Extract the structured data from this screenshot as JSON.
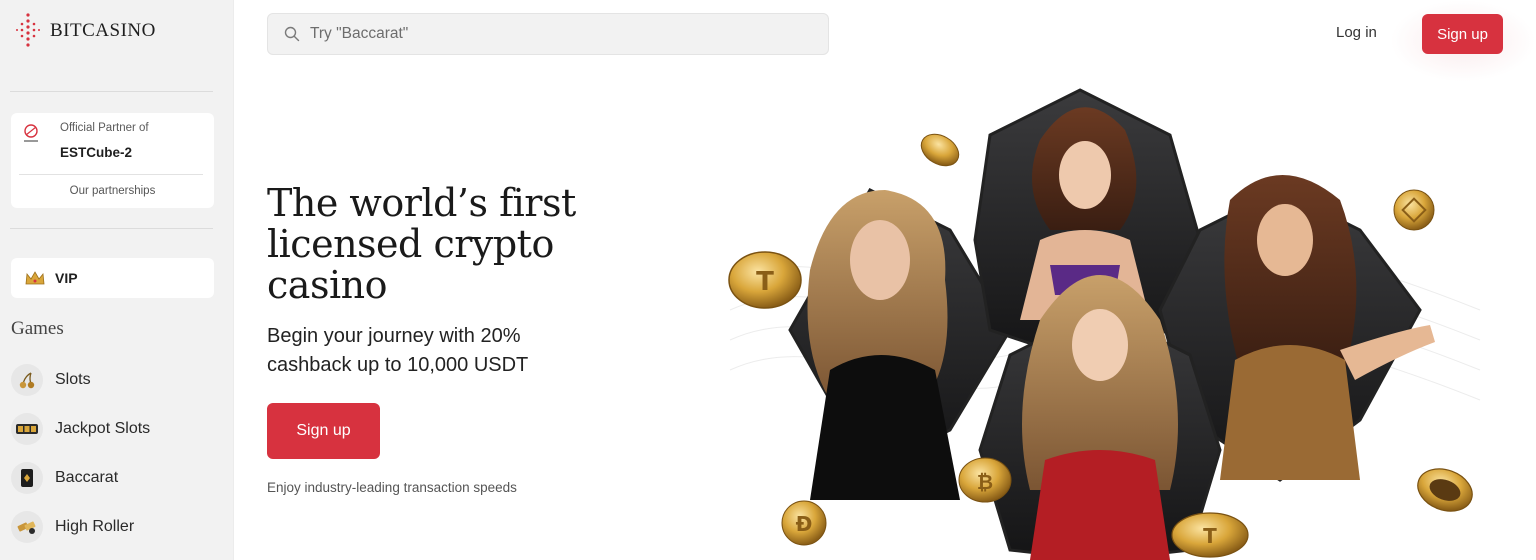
{
  "brand": {
    "name": "BITCASINO",
    "accent": "#d7323f"
  },
  "partner": {
    "label": "Official Partner of",
    "name": "ESTCube-2",
    "link": "Our partnerships"
  },
  "sidebar": {
    "vip": {
      "label": "VIP",
      "icon": "crown-icon"
    },
    "section_title": "Games",
    "items": [
      {
        "label": "Slots",
        "icon": "cherries-icon"
      },
      {
        "label": "Jackpot Slots",
        "icon": "slot-reels-icon"
      },
      {
        "label": "Baccarat",
        "icon": "card-icon"
      },
      {
        "label": "High Roller",
        "icon": "chips-icon"
      }
    ]
  },
  "header": {
    "search_placeholder": "Try \"Baccarat\"",
    "login": "Log in",
    "signup": "Sign up"
  },
  "hero": {
    "title": "The world’s first licensed crypto casino",
    "subtitle": "Begin your journey with 20% cashback up to 10,000 USDT",
    "cta": "Sign up",
    "note": "Enjoy industry-leading transaction speeds"
  }
}
